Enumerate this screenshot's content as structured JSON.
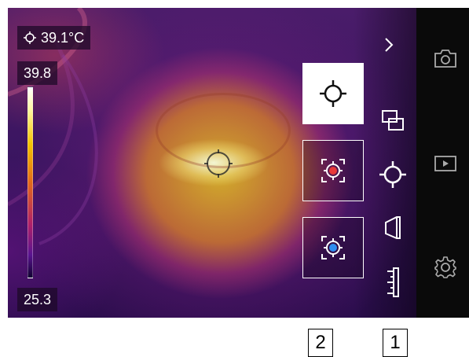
{
  "readout": {
    "spot_temperature": "39.1°C",
    "icon": "crosshair-icon"
  },
  "scale": {
    "max": "39.8",
    "min": "25.3",
    "palette": "iron"
  },
  "tools": {
    "spot": {
      "icon": "crosshair-icon",
      "selected": true
    },
    "hot_spot": {
      "icon": "hot-spot-icon",
      "color": "#e83a3a"
    },
    "cold_spot": {
      "icon": "cold-spot-icon",
      "color": "#2f8ef0"
    }
  },
  "toolbar": {
    "items": [
      "chevron-right-icon",
      "picture-in-picture-icon",
      "crosshair-icon",
      "perspective-icon",
      "ruler-icon"
    ]
  },
  "side_panel": {
    "items": [
      "camera-icon",
      "play-icon",
      "gear-icon"
    ]
  },
  "callouts": {
    "one": "1",
    "two": "2"
  }
}
